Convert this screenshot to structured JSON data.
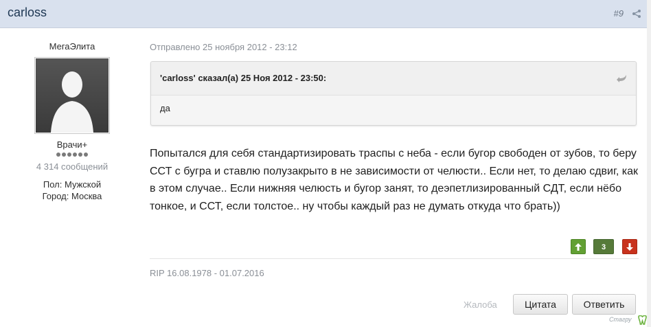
{
  "post": {
    "author": "carloss",
    "number": "#9",
    "posted": "Отправлено 25 ноября 2012 - 23:12"
  },
  "author_info": {
    "group": "МегаЭлита",
    "rank": "Врачи+",
    "pips": 6,
    "post_count": "4 314 сообщений",
    "gender_label": "Пол:",
    "gender": "Мужской",
    "city_label": "Город:",
    "city": "Москва"
  },
  "quote": {
    "citation": "'carloss' сказал(а) 25 Ноя 2012 - 23:50:",
    "text": "да"
  },
  "body": "Попытался для себя стандартизировать траспы с неба - если бугор свободен от зубов, то беру ССТ с бугра и ставлю полузакрыто в не зависимости от челюсти.. Если нет, то делаю сдвиг, как в этом случае.. Если нижняя челюсть и бугор занят, то деэпетлизированный СДТ, если нёбо тонкое, и ССТ, если толстое.. ну чтобы каждый раз не думать откуда что брать))",
  "reputation": {
    "count": "3"
  },
  "signature": "RIP 16.08.1978 - 01.07.2016",
  "actions": {
    "report": "Жалоба",
    "quote": "Цитата",
    "reply": "Ответить"
  },
  "brand": "Стагру",
  "colors": {
    "header_bg": "#d9e1ee",
    "author_link": "#1d3652",
    "rep_up": "#62a033",
    "rep_count": "#567a39",
    "rep_down": "#c8321d"
  },
  "icons": [
    "share-icon",
    "avatar-silhouette-icon",
    "quote-snapback-icon",
    "arrow-up-icon",
    "arrow-down-icon",
    "tooth-logo-icon"
  ]
}
